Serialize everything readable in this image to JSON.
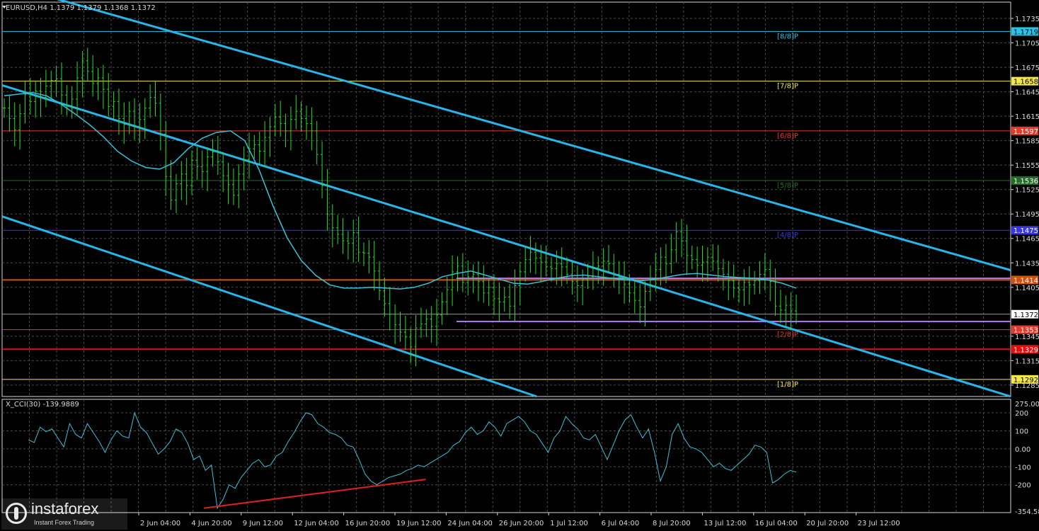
{
  "header": {
    "symbol_label": "EURUSD,H4  1.1379 1.1379 1.1368 1.1372",
    "cci_label": "X_CCI(30) -139.9889"
  },
  "chart_data": {
    "type": "line",
    "title": "EURUSD,H4",
    "ohlc_last": {
      "open": 1.1379,
      "high": 1.1379,
      "low": 1.1368,
      "close": 1.1372
    },
    "price_axis": {
      "ylim": [
        1.1271,
        1.1755
      ],
      "ticks": [
        "1.1735",
        "1.1705",
        "1.1675",
        "1.1645",
        "1.1615",
        "1.1585",
        "1.1555",
        "1.1525",
        "1.1495",
        "1.1465",
        "1.1435",
        "1.1405",
        "1.1345",
        "1.1315",
        "1.1285"
      ]
    },
    "time_axis": {
      "ticks": [
        "2 Jun 04:00",
        "4 Jun 20:00",
        "9 Jun 12:00",
        "12 Jun 04:00",
        "16 Jun 20:00",
        "19 Jun 12:00",
        "24 Jun 04:00",
        "26 Jun 20:00",
        "1 Jul 12:00",
        "6 Jul 04:00",
        "8 Jul 20:00",
        "13 Jul 12:00",
        "16 Jul 04:00",
        "20 Jul 20:00",
        "23 Jul 12:00"
      ]
    },
    "price_series": {
      "name": "EURUSD close",
      "values": [
        1.1625,
        1.1612,
        1.1598,
        1.1618,
        1.1642,
        1.1633,
        1.1646,
        1.1638,
        1.1652,
        1.1659,
        1.1661,
        1.1641,
        1.1628,
        1.1636,
        1.1662,
        1.1683,
        1.167,
        1.1655,
        1.1662,
        1.1648,
        1.1627,
        1.1633,
        1.1612,
        1.1605,
        1.1621,
        1.1602,
        1.1611,
        1.1625,
        1.1638,
        1.1631,
        1.1593,
        1.1541,
        1.1512,
        1.1532,
        1.1544,
        1.153,
        1.1561,
        1.1553,
        1.1547,
        1.1565,
        1.1571,
        1.1559,
        1.1542,
        1.1531,
        1.1518,
        1.1544,
        1.1562,
        1.1575,
        1.158,
        1.1572,
        1.1589,
        1.1602,
        1.1614,
        1.1606,
        1.1597,
        1.1611,
        1.1621,
        1.1612,
        1.1606,
        1.1597,
        1.1568,
        1.153,
        1.1495,
        1.1478,
        1.147,
        1.1462,
        1.1459,
        1.1472,
        1.1448,
        1.1447,
        1.1442,
        1.1425,
        1.1401,
        1.1385,
        1.1372,
        1.1359,
        1.135,
        1.1344,
        1.1332,
        1.1355,
        1.136,
        1.1366,
        1.1357,
        1.1371,
        1.1387,
        1.1402,
        1.1424,
        1.1431,
        1.1411,
        1.1418,
        1.1421,
        1.1412,
        1.1398,
        1.1405,
        1.1391,
        1.1387,
        1.1393,
        1.1382,
        1.1407,
        1.1424,
        1.1439,
        1.1448,
        1.1441,
        1.1436,
        1.143,
        1.1428,
        1.1434,
        1.143,
        1.1421,
        1.1412,
        1.1407,
        1.1415,
        1.1418,
        1.1429,
        1.1431,
        1.1437,
        1.1434,
        1.1421,
        1.1417,
        1.1409,
        1.1398,
        1.1389,
        1.1381,
        1.14,
        1.1416,
        1.1427,
        1.1442,
        1.1434,
        1.1451,
        1.1473,
        1.1462,
        1.1444,
        1.1439,
        1.1432,
        1.1436,
        1.1442,
        1.1437,
        1.1428,
        1.1421,
        1.1413,
        1.1404,
        1.1402,
        1.1411,
        1.1408,
        1.1413,
        1.1421,
        1.1427,
        1.1412,
        1.1382,
        1.1377,
        1.1383,
        1.1376,
        1.1372
      ]
    },
    "ma_series": {
      "name": "moving average",
      "values": [
        1.164,
        1.1642,
        1.1644,
        1.164,
        1.163,
        1.1618,
        1.1605,
        1.159,
        1.1572,
        1.156,
        1.1552,
        1.155,
        1.1558,
        1.1575,
        1.1588,
        1.1595,
        1.1597,
        1.1585,
        1.155,
        1.1505,
        1.1466,
        1.1438,
        1.142,
        1.1408,
        1.1404,
        1.1404,
        1.1405,
        1.1404,
        1.1403,
        1.1405,
        1.141,
        1.1418,
        1.1422,
        1.1425,
        1.142,
        1.1415,
        1.141,
        1.1409,
        1.1412,
        1.1416,
        1.1419,
        1.142,
        1.1418,
        1.1416,
        1.1414,
        1.1413,
        1.1415,
        1.1418,
        1.1421,
        1.1422,
        1.142,
        1.1418,
        1.1417,
        1.1416,
        1.1414,
        1.141,
        1.1404
      ]
    },
    "channel_lines": [
      {
        "name": "upper channel",
        "from": [
          0.0,
          1.1778
        ],
        "to": [
          1.0,
          1.1426
        ]
      },
      {
        "name": "middle channel",
        "from": [
          0.0,
          1.1653
        ],
        "to": [
          1.0,
          1.1271
        ]
      },
      {
        "name": "lower channel",
        "from": [
          0.0,
          1.1492
        ],
        "to": [
          0.53,
          1.1271
        ]
      }
    ],
    "murrey_levels": [
      {
        "price": 1.1719,
        "label": "[8/8]P",
        "axis_label": "1.1719",
        "color": "#27c4e8",
        "axis_text": "#000000"
      },
      {
        "price": 1.1658,
        "label": "[7/8]P",
        "axis_label": "1.1658",
        "color": "#f5e64c",
        "axis_text": "#000000"
      },
      {
        "price": 1.1597,
        "label": "[6/8]P",
        "axis_label": "1.1597",
        "color": "#e43a2e",
        "axis_text": "#ffffff"
      },
      {
        "price": 1.1536,
        "label": "[5/8]P",
        "axis_label": "1.1536",
        "color": "#1f6f24",
        "axis_text": "#ffffff"
      },
      {
        "price": 1.1475,
        "label": "[4/8]P",
        "axis_label": "1.1475",
        "color": "#3a35e6",
        "axis_text": "#ffffff"
      },
      {
        "price": 1.1353,
        "label": "[2/8]P",
        "axis_label": "1.1353",
        "color": "#e43a2e",
        "axis_text": "#ffffff"
      },
      {
        "price": 1.1292,
        "label": "[1/8]P",
        "axis_label": "1.1292",
        "color": "#f5e64c",
        "axis_text": "#000000"
      }
    ],
    "support_resistance": [
      {
        "price": 1.1414,
        "axis_label": "1.1414",
        "color": "#d0520f",
        "axis_text": "#ffffff"
      },
      {
        "price": 1.1329,
        "axis_label": "1.1329",
        "color": "#e60d0d",
        "axis_text": "#ffffff"
      },
      {
        "price": 1.1416,
        "color": "#b37cf5"
      },
      {
        "price": 1.1363,
        "color": "#b37cf5"
      }
    ],
    "last_price": {
      "price": 1.1372,
      "axis_label": "1.1372"
    },
    "cci": {
      "name": "X_CCI(30)",
      "value": -139.9889,
      "ylim": [
        -354.583,
        275.0021
      ],
      "ticks": [
        "275.0021",
        "200",
        "100",
        "0.00",
        "-100",
        "-200",
        "-354.583"
      ],
      "values": [
        50,
        35,
        120,
        95,
        110,
        60,
        10,
        140,
        80,
        60,
        140,
        90,
        40,
        -20,
        50,
        100,
        70,
        60,
        200,
        120,
        90,
        30,
        -30,
        0,
        40,
        110,
        90,
        30,
        -60,
        -40,
        -120,
        -90,
        -330,
        -280,
        -200,
        -220,
        -160,
        -120,
        -80,
        -60,
        -100,
        -90,
        -40,
        -20,
        40,
        90,
        150,
        200,
        190,
        140,
        120,
        90,
        80,
        60,
        20,
        10,
        -60,
        -140,
        -180,
        -200,
        -180,
        -160,
        -150,
        -140,
        -120,
        -110,
        -90,
        -100,
        -80,
        -60,
        -40,
        -20,
        20,
        40,
        90,
        120,
        80,
        100,
        150,
        120,
        70,
        140,
        160,
        180,
        150,
        100,
        80,
        30,
        -20,
        60,
        100,
        180,
        140,
        110,
        60,
        50,
        80,
        10,
        -60,
        20,
        100,
        160,
        190,
        120,
        60,
        110,
        -20,
        -180,
        -100,
        80,
        140,
        60,
        10,
        0,
        -20,
        -60,
        -100,
        -80,
        -110,
        -120,
        -90,
        -60,
        -30,
        20,
        10,
        -20,
        -190,
        -170,
        -140,
        -120,
        -130
      ]
    },
    "cci_trendline": {
      "from": [
        0.2,
        -330
      ],
      "to": [
        0.42,
        -170
      ]
    }
  },
  "logo": {
    "brand": "instaforex",
    "tagline": "Instant Forex Trading"
  }
}
